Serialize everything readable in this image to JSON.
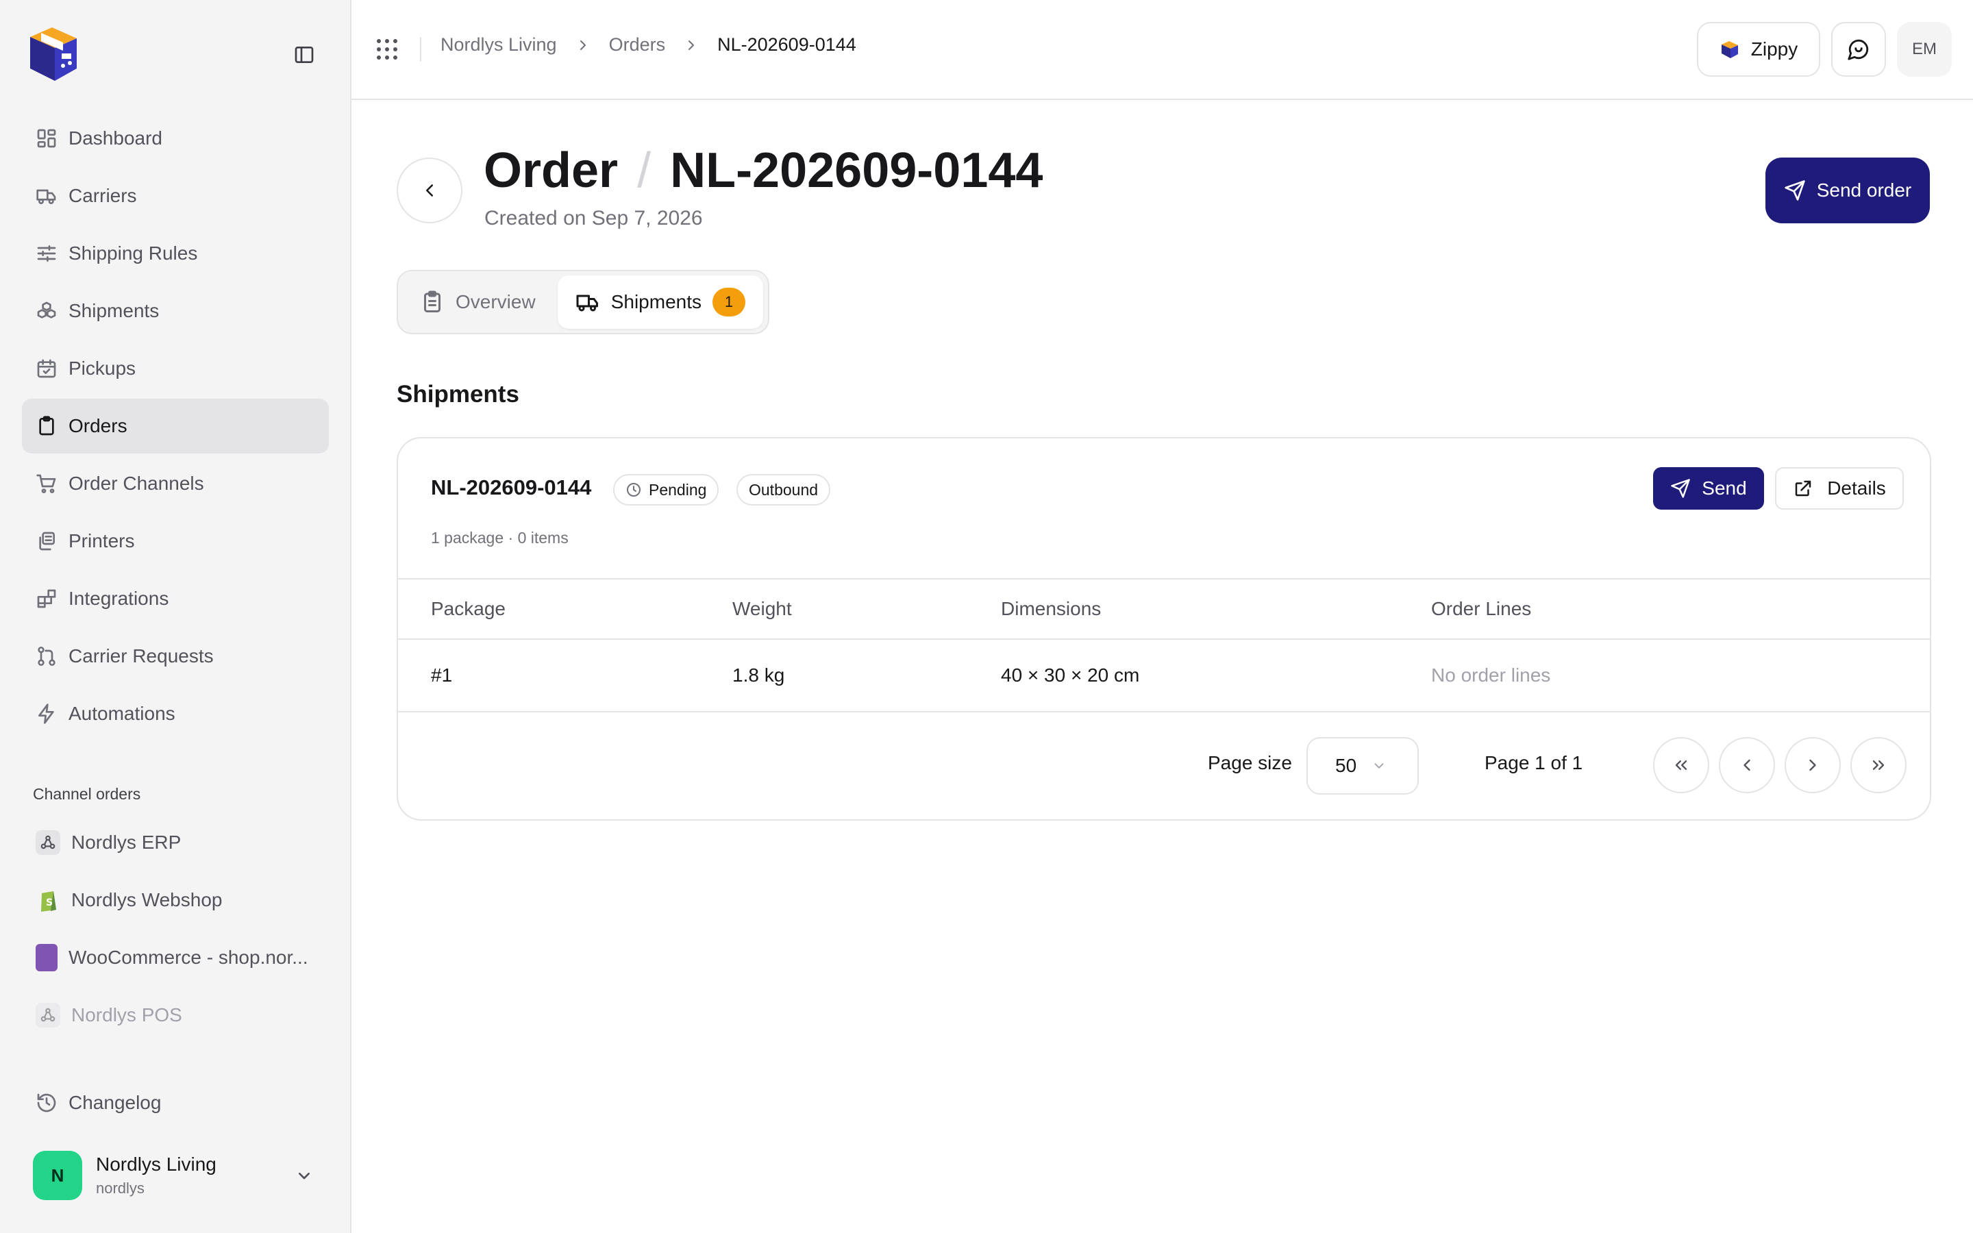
{
  "sidebar": {
    "nav": [
      {
        "label": "Dashboard",
        "icon": "layout-dashboard-icon"
      },
      {
        "label": "Carriers",
        "icon": "truck-icon"
      },
      {
        "label": "Shipping Rules",
        "icon": "sliders-icon"
      },
      {
        "label": "Shipments",
        "icon": "boxes-icon"
      },
      {
        "label": "Pickups",
        "icon": "calendar-check-icon"
      },
      {
        "label": "Orders",
        "icon": "clipboard-icon",
        "active": true
      },
      {
        "label": "Order Channels",
        "icon": "shopping-cart-icon"
      },
      {
        "label": "Printers",
        "icon": "printer-icon"
      },
      {
        "label": "Integrations",
        "icon": "blocks-icon"
      },
      {
        "label": "Carrier Requests",
        "icon": "git-pull-request-icon"
      },
      {
        "label": "Automations",
        "icon": "zap-icon"
      }
    ],
    "channels_label": "Channel orders",
    "channels": [
      {
        "label": "Nordlys ERP",
        "icon": "webhook-icon"
      },
      {
        "label": "Nordlys Webshop",
        "icon": "shopify-icon"
      },
      {
        "label": "WooCommerce - shop.nor...",
        "icon": "woocommerce-icon"
      },
      {
        "label": "Nordlys POS",
        "icon": "webhook-icon",
        "muted": true
      }
    ],
    "changelog_label": "Changelog",
    "account": {
      "initial": "N",
      "name": "Nordlys Living",
      "slug": "nordlys"
    }
  },
  "header": {
    "breadcrumb": [
      "Nordlys Living",
      "Orders",
      "NL-202609-0144"
    ],
    "zippy_label": "Zippy",
    "user_initials": "EM"
  },
  "page": {
    "title": "Order",
    "order_id": "NL-202609-0144",
    "created": "Created on Sep 7, 2026",
    "send_order_label": "Send order",
    "tabs": [
      {
        "label": "Overview",
        "icon": "clipboard-list-icon"
      },
      {
        "label": "Shipments",
        "icon": "truck-icon",
        "count": "1",
        "active": true
      }
    ],
    "section_title": "Shipments"
  },
  "shipment": {
    "id": "NL-202609-0144",
    "status": "Pending",
    "direction": "Outbound",
    "meta": "1 package · 0 items",
    "send_label": "Send",
    "details_label": "Details",
    "columns": [
      "Package",
      "Weight",
      "Dimensions",
      "Order Lines"
    ],
    "rows": [
      {
        "package": "#1",
        "weight": "1.8 kg",
        "dimensions": "40 × 30 × 20 cm",
        "order_lines": "No order lines"
      }
    ],
    "pagination": {
      "page_size_label": "Page size",
      "page_size": "50",
      "page_info": "Page 1 of 1"
    }
  },
  "colors": {
    "accent": "#1e1b7a",
    "badge": "#f59e0b",
    "avatar_green": "#22d38a",
    "woo_purple": "#7f54b3",
    "logo_orange": "#f5a623",
    "logo_navy": "#2b2a8c"
  }
}
